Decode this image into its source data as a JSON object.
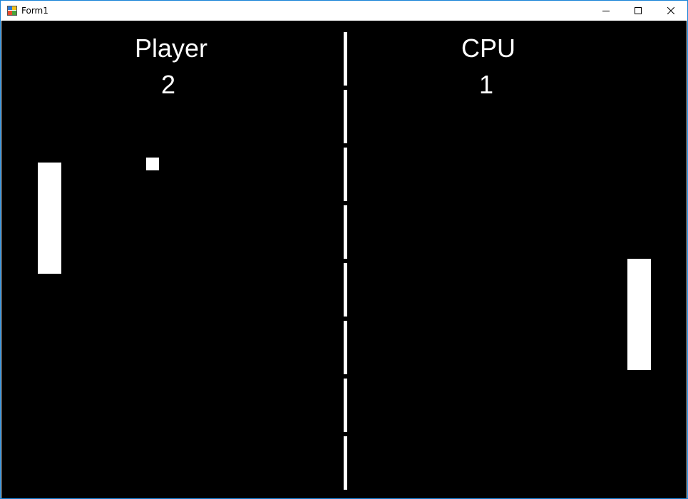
{
  "window": {
    "title": "Form1",
    "app_icon": "winforms-app-icon",
    "buttons": {
      "minimize": "minimize-icon",
      "maximize": "maximize-icon",
      "close": "close-icon"
    },
    "border_color": "#1883d7"
  },
  "game": {
    "background_color": "#000000",
    "foreground_color": "#ffffff",
    "player": {
      "label": "Player",
      "score": "2"
    },
    "cpu": {
      "label": "CPU",
      "score": "1"
    },
    "net_segments": 8
  }
}
